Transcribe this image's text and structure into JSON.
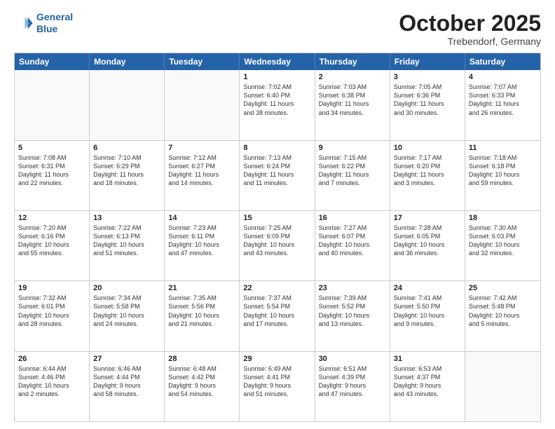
{
  "header": {
    "logo_line1": "General",
    "logo_line2": "Blue",
    "month": "October 2025",
    "location": "Trebendorf, Germany"
  },
  "weekdays": [
    "Sunday",
    "Monday",
    "Tuesday",
    "Wednesday",
    "Thursday",
    "Friday",
    "Saturday"
  ],
  "rows": [
    [
      {
        "day": "",
        "text": "",
        "empty": true
      },
      {
        "day": "",
        "text": "",
        "empty": true
      },
      {
        "day": "",
        "text": "",
        "empty": true
      },
      {
        "day": "1",
        "text": "Sunrise: 7:02 AM\nSunset: 6:40 PM\nDaylight: 11 hours\nand 38 minutes."
      },
      {
        "day": "2",
        "text": "Sunrise: 7:03 AM\nSunset: 6:38 PM\nDaylight: 11 hours\nand 34 minutes."
      },
      {
        "day": "3",
        "text": "Sunrise: 7:05 AM\nSunset: 6:36 PM\nDaylight: 11 hours\nand 30 minutes."
      },
      {
        "day": "4",
        "text": "Sunrise: 7:07 AM\nSunset: 6:33 PM\nDaylight: 11 hours\nand 26 minutes."
      }
    ],
    [
      {
        "day": "5",
        "text": "Sunrise: 7:08 AM\nSunset: 6:31 PM\nDaylight: 11 hours\nand 22 minutes."
      },
      {
        "day": "6",
        "text": "Sunrise: 7:10 AM\nSunset: 6:29 PM\nDaylight: 11 hours\nand 18 minutes."
      },
      {
        "day": "7",
        "text": "Sunrise: 7:12 AM\nSunset: 6:27 PM\nDaylight: 11 hours\nand 14 minutes."
      },
      {
        "day": "8",
        "text": "Sunrise: 7:13 AM\nSunset: 6:24 PM\nDaylight: 11 hours\nand 11 minutes."
      },
      {
        "day": "9",
        "text": "Sunrise: 7:15 AM\nSunset: 6:22 PM\nDaylight: 11 hours\nand 7 minutes."
      },
      {
        "day": "10",
        "text": "Sunrise: 7:17 AM\nSunset: 6:20 PM\nDaylight: 11 hours\nand 3 minutes."
      },
      {
        "day": "11",
        "text": "Sunrise: 7:18 AM\nSunset: 6:18 PM\nDaylight: 10 hours\nand 59 minutes."
      }
    ],
    [
      {
        "day": "12",
        "text": "Sunrise: 7:20 AM\nSunset: 6:16 PM\nDaylight: 10 hours\nand 55 minutes."
      },
      {
        "day": "13",
        "text": "Sunrise: 7:22 AM\nSunset: 6:13 PM\nDaylight: 10 hours\nand 51 minutes."
      },
      {
        "day": "14",
        "text": "Sunrise: 7:23 AM\nSunset: 6:11 PM\nDaylight: 10 hours\nand 47 minutes."
      },
      {
        "day": "15",
        "text": "Sunrise: 7:25 AM\nSunset: 6:09 PM\nDaylight: 10 hours\nand 43 minutes."
      },
      {
        "day": "16",
        "text": "Sunrise: 7:27 AM\nSunset: 6:07 PM\nDaylight: 10 hours\nand 40 minutes."
      },
      {
        "day": "17",
        "text": "Sunrise: 7:28 AM\nSunset: 6:05 PM\nDaylight: 10 hours\nand 36 minutes."
      },
      {
        "day": "18",
        "text": "Sunrise: 7:30 AM\nSunset: 6:03 PM\nDaylight: 10 hours\nand 32 minutes."
      }
    ],
    [
      {
        "day": "19",
        "text": "Sunrise: 7:32 AM\nSunset: 6:01 PM\nDaylight: 10 hours\nand 28 minutes."
      },
      {
        "day": "20",
        "text": "Sunrise: 7:34 AM\nSunset: 5:58 PM\nDaylight: 10 hours\nand 24 minutes."
      },
      {
        "day": "21",
        "text": "Sunrise: 7:35 AM\nSunset: 5:56 PM\nDaylight: 10 hours\nand 21 minutes."
      },
      {
        "day": "22",
        "text": "Sunrise: 7:37 AM\nSunset: 5:54 PM\nDaylight: 10 hours\nand 17 minutes."
      },
      {
        "day": "23",
        "text": "Sunrise: 7:39 AM\nSunset: 5:52 PM\nDaylight: 10 hours\nand 13 minutes."
      },
      {
        "day": "24",
        "text": "Sunrise: 7:41 AM\nSunset: 5:50 PM\nDaylight: 10 hours\nand 9 minutes."
      },
      {
        "day": "25",
        "text": "Sunrise: 7:42 AM\nSunset: 5:48 PM\nDaylight: 10 hours\nand 5 minutes."
      }
    ],
    [
      {
        "day": "26",
        "text": "Sunrise: 6:44 AM\nSunset: 4:46 PM\nDaylight: 10 hours\nand 2 minutes."
      },
      {
        "day": "27",
        "text": "Sunrise: 6:46 AM\nSunset: 4:44 PM\nDaylight: 9 hours\nand 58 minutes."
      },
      {
        "day": "28",
        "text": "Sunrise: 6:48 AM\nSunset: 4:42 PM\nDaylight: 9 hours\nand 54 minutes."
      },
      {
        "day": "29",
        "text": "Sunrise: 6:49 AM\nSunset: 4:41 PM\nDaylight: 9 hours\nand 51 minutes."
      },
      {
        "day": "30",
        "text": "Sunrise: 6:51 AM\nSunset: 4:39 PM\nDaylight: 9 hours\nand 47 minutes."
      },
      {
        "day": "31",
        "text": "Sunrise: 6:53 AM\nSunset: 4:37 PM\nDaylight: 9 hours\nand 43 minutes."
      },
      {
        "day": "",
        "text": "",
        "empty": true
      }
    ]
  ]
}
